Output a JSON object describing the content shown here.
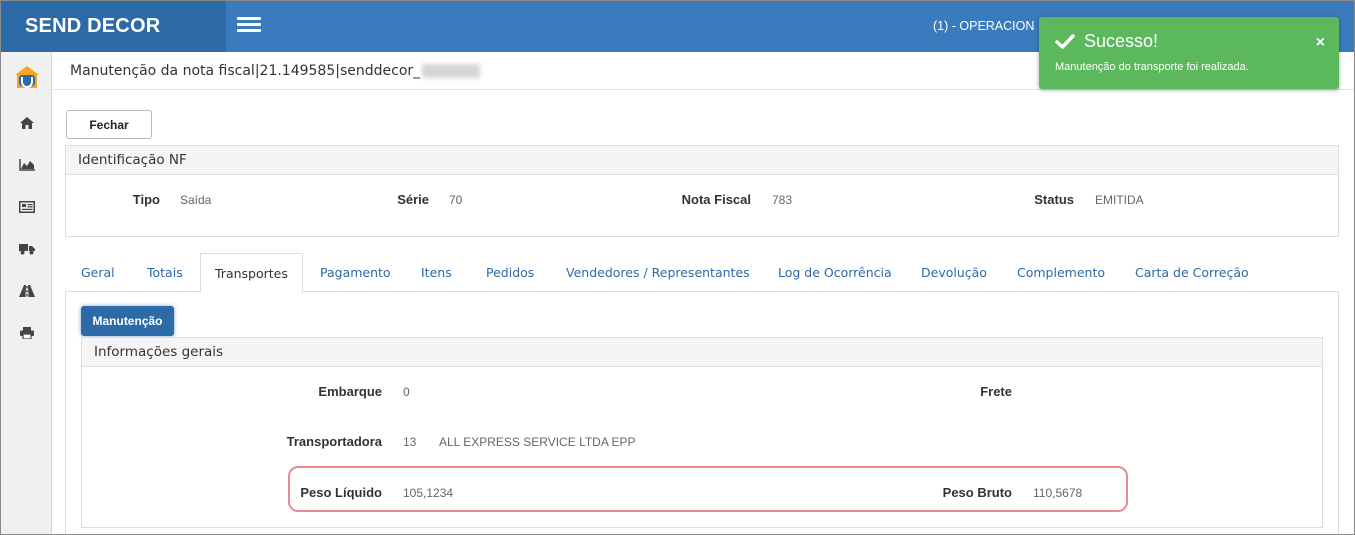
{
  "brand": "SEND DECOR",
  "header": {
    "user_label": "(1) - OPERACION"
  },
  "page_title": "Manutenção da nota fiscal|21.149585|senddecor_",
  "buttons": {
    "fechar": "Fechar",
    "manutencao": "Manutenção"
  },
  "identificacao": {
    "title": "Identificação NF",
    "fields": {
      "tipo_label": "Tipo",
      "tipo_value": "Saída",
      "serie_label": "Série",
      "serie_value": "70",
      "nota_label": "Nota Fiscal",
      "nota_value": "783",
      "status_label": "Status",
      "status_value": "EMITIDA"
    }
  },
  "tabs": [
    {
      "label": "Geral"
    },
    {
      "label": "Totais"
    },
    {
      "label": "Transportes"
    },
    {
      "label": "Pagamento"
    },
    {
      "label": "Itens"
    },
    {
      "label": "Pedidos"
    },
    {
      "label": "Vendedores / Representantes"
    },
    {
      "label": "Log de Ocorrência"
    },
    {
      "label": "Devolução"
    },
    {
      "label": "Complemento"
    },
    {
      "label": "Carta de Correção"
    }
  ],
  "active_tab": "Transportes",
  "informacoes": {
    "title": "Informações gerais",
    "embarque_label": "Embarque",
    "embarque_value": "0",
    "frete_label": "Frete",
    "transportadora_label": "Transportadora",
    "transportadora_code": "13",
    "transportadora_name": "ALL EXPRESS SERVICE LTDA EPP",
    "peso_liquido_label": "Peso Líquido",
    "peso_liquido_value": "105,1234",
    "peso_bruto_label": "Peso Bruto",
    "peso_bruto_value": "110,5678"
  },
  "toast": {
    "title": "Sucesso!",
    "message": "Manutenção do transporte foi realizada.",
    "close": "×"
  },
  "sidebar": {
    "items": [
      {
        "icon": "logo-icon"
      },
      {
        "icon": "home-icon"
      },
      {
        "icon": "area-chart-icon"
      },
      {
        "icon": "newspaper-icon"
      },
      {
        "icon": "truck-icon"
      },
      {
        "icon": "road-icon"
      },
      {
        "icon": "print-icon"
      }
    ]
  },
  "colors": {
    "header": "#3a7bbd",
    "brand_bg": "#2c6aa8",
    "toast": "#5cb85c",
    "highlight": "#e88a95",
    "tab_link": "#2c6aa8"
  }
}
